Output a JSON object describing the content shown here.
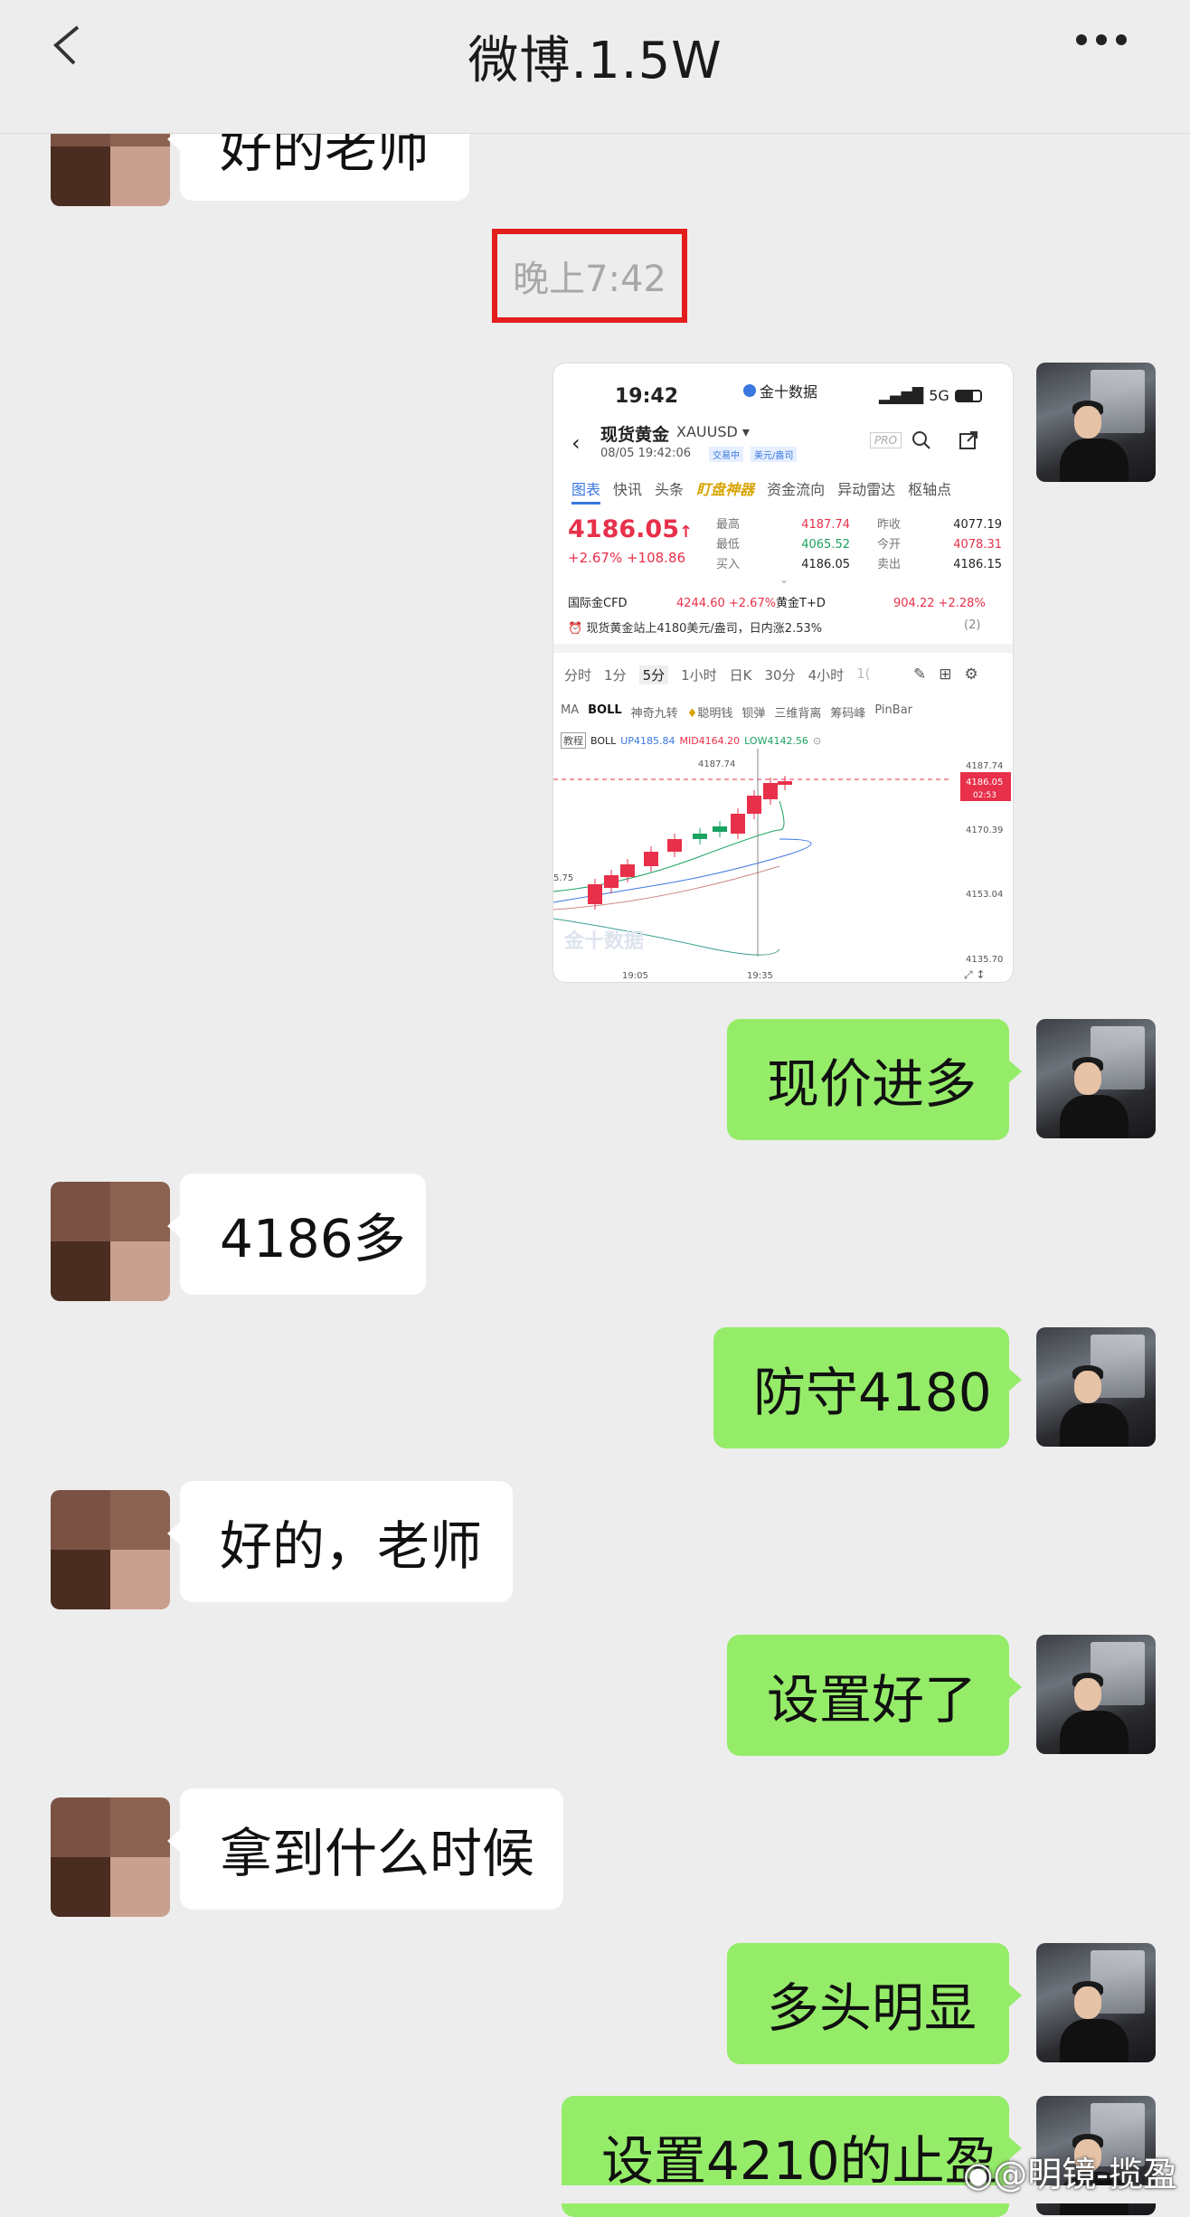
{
  "header": {
    "title": "微博.1.5W"
  },
  "timestamp": "晚上7:42",
  "messages": {
    "m0": "好的老师",
    "m1": "现价进多",
    "m2": "4186多",
    "m3": "防守4180",
    "m4": "好的，老师",
    "m5": "设置好了",
    "m6": "拿到什么时候",
    "m7": "多头明显",
    "m8": "设置4210的止盈"
  },
  "screenshot": {
    "status_time": "19:42",
    "status_center": "金十数据",
    "status_net": "5G",
    "name": "现货黄金",
    "symbol": "XAUUSD",
    "pro": "PRO",
    "date": "08/05 19:42:06",
    "trade_tag": "交易中",
    "unit_tag": "美元/盎司",
    "tabs": [
      "图表",
      "快讯",
      "头条",
      "盯盘神器",
      "资金流向",
      "异动雷达",
      "枢轴点"
    ],
    "price": "4186.05",
    "change": "+2.67%  +108.86",
    "stats": [
      {
        "l": "最高",
        "v": "4187.74",
        "l2": "昨收",
        "v2": "4077.19"
      },
      {
        "l": "最低",
        "v": "4065.52",
        "l2": "今开",
        "v2": "4078.31"
      },
      {
        "l": "买入",
        "v": "4186.05",
        "l2": "卖出",
        "v2": "4186.15"
      }
    ],
    "cfd_label": "国际金CFD",
    "cfd_value": "4244.60  +2.67%",
    "td_label": "黄金T+D",
    "td_value": "904.22  +2.28%",
    "news": "现货黄金站上4180美元/盎司，日内涨2.53%",
    "news_count": "(2)",
    "periods": [
      "分时",
      "1分",
      "5分",
      "1小时",
      "日K",
      "30分",
      "4小时",
      "1("
    ],
    "indicators": [
      "MA",
      "BOLL",
      "神奇九转",
      "聪明钱",
      "钡弹",
      "三维背离",
      "筹码峰",
      "PinBar"
    ],
    "boll_tag": "教程",
    "boll_line": "BOLL",
    "boll_up": "UP4185.84",
    "boll_mid": "MID4164.20",
    "boll_low": "LOW4142.56",
    "chart_high": "4187.74",
    "chart_low": "5.75",
    "axis": [
      "4187.74",
      "4170.39",
      "4153.04",
      "4135.70"
    ],
    "price_tag": "4186.05",
    "price_tag_time": "02:53",
    "x_ticks": [
      "19:05",
      "19:35"
    ],
    "logo": "金十数据",
    "colors": {
      "up": "#e8304a",
      "down": "#1aa260",
      "accent": "#3a77e0"
    }
  },
  "footer": {
    "watermark": "@明镜-揽盈"
  }
}
